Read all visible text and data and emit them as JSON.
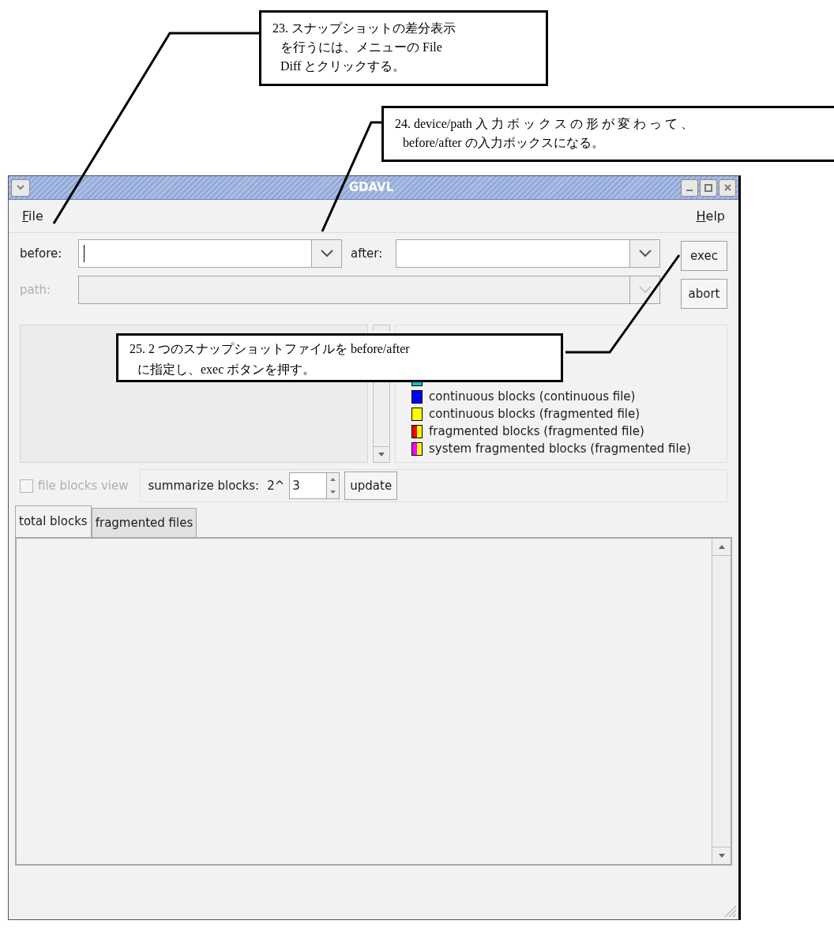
{
  "callouts": [
    {
      "text": "23. スナップショットの差分表示を行うには、メニューの File Diff とクリックする。"
    },
    {
      "text": "24.  device/path  入 力 ボ ッ ク ス の 形 が 変 わ っ て 、 before/after の入力ボックスになる。"
    },
    {
      "text": "25.  2 つのスナップショットファイルを  before/afterに指定し、exec ボタンを押す。"
    }
  ],
  "window": {
    "title": "GDAVL"
  },
  "menu": [
    {
      "label": "File"
    },
    {
      "label": "Help"
    }
  ],
  "before": {
    "label": "before:",
    "focused": true
  },
  "after": {
    "label": "after:"
  },
  "path": {
    "label": "path:",
    "disabled": true
  },
  "buttons": [
    {
      "label": "exec"
    },
    {
      "label": "abort"
    }
  ],
  "legend": [
    {
      "swatch": [
        {
          "color": "#00c8c8"
        }
      ]
    },
    {
      "label": "continuous blocks (continuous file)",
      "swatch": [
        {
          "color": "#0000ff"
        }
      ]
    },
    {
      "label": "continuous blocks (fragmented file)",
      "swatch": [
        {
          "color": "#ffff00"
        }
      ]
    },
    {
      "label": "fragmented blocks (fragmented file)",
      "swatch": [
        {
          "color": "#ff0000"
        },
        {
          "color": "#ffff00"
        }
      ]
    },
    {
      "label": "system fragmented blocks (fragmented file)",
      "swatch": [
        {
          "color": "#ff00ff"
        },
        {
          "color": "#ffff00"
        }
      ]
    }
  ],
  "file_blocks_view": {
    "label": "file blocks view",
    "checked": false,
    "disabled": true
  },
  "summarize": {
    "label": "summarize blocks:",
    "prefix": "2^",
    "value": "3",
    "button": "update"
  },
  "tabs": [
    {
      "label": "total blocks",
      "selected": true
    },
    {
      "label": "fragmented files",
      "selected": false
    }
  ]
}
